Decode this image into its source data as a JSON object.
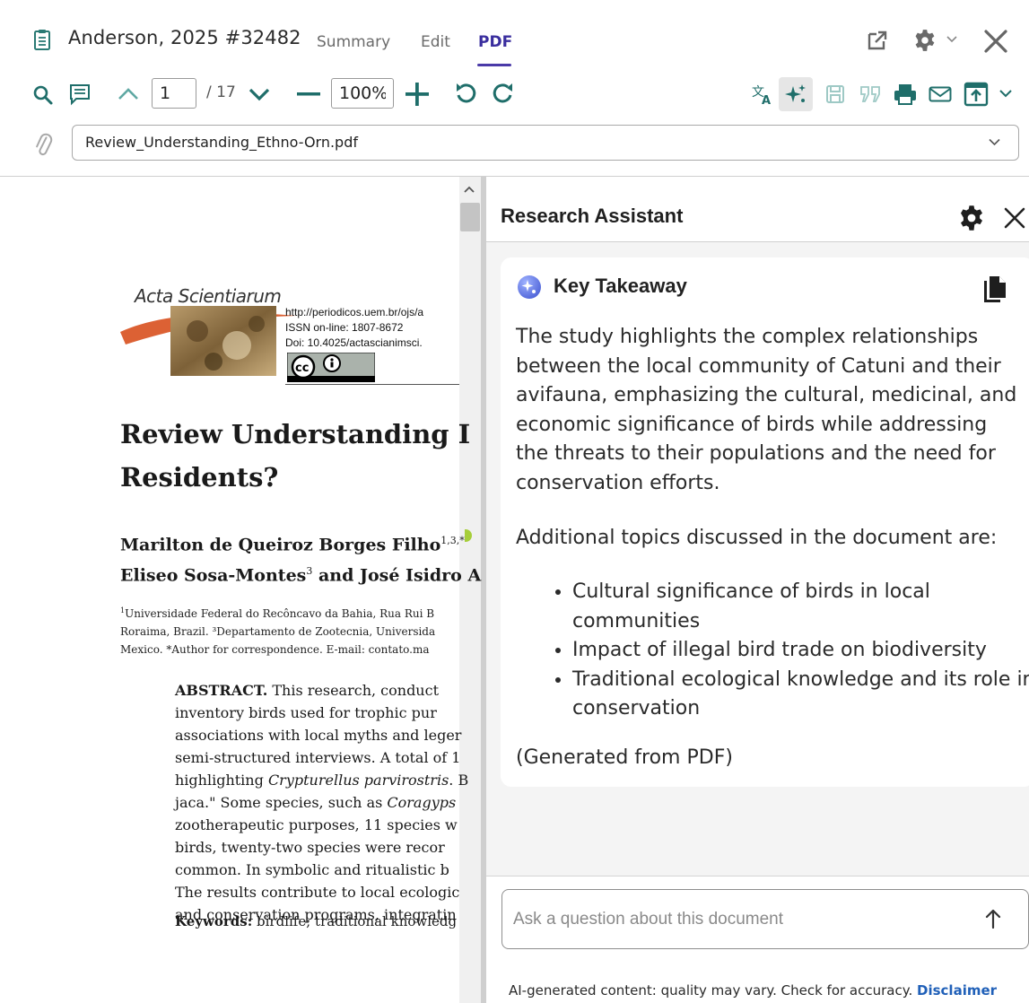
{
  "header": {
    "reference_title": "Anderson, 2025 #32482",
    "tabs": [
      {
        "label": "Summary",
        "active": false
      },
      {
        "label": "Edit",
        "active": false
      },
      {
        "label": "PDF",
        "active": true
      }
    ]
  },
  "toolbar": {
    "page_current": "1",
    "page_total": "/ 17",
    "zoom": "100%"
  },
  "attachment": {
    "file_name": "Review_Understanding_Ethno-Orn.pdf"
  },
  "pdf": {
    "journal_name": "Acta Scientiarum",
    "journal_url": "http://periodicos.uem.br/ojs/a",
    "issn": "ISSN on-line: 1807-8672",
    "doi": "Doi: 10.4025/actascianimsci.",
    "title_lines": [
      "Review Understanding I",
      "Residents?"
    ],
    "author_lines": [
      "Marilton de Queiroz Borges Filho",
      "Eliseo Sosa-Montes",
      " and José Isidro A"
    ],
    "author_sup_1": "1,3,*",
    "author_sup_2": "3",
    "affiliation_lines": [
      "Universidade Federal do Recôncavo da Bahia, Rua Rui B",
      "Roraima, Brazil. ³Departamento de Zootecnia, Universida",
      "Mexico. *Author for correspondence. E-mail: contato.ma"
    ],
    "affiliation_sup": "1",
    "abstract_label": "ABSTRACT.",
    "abstract_first": " This research, conduct",
    "abstract_lines": [
      "inventory birds used for trophic pur",
      "associations with local myths and leger",
      "semi-structured interviews. A total of 1",
      "highlighting ",
      "jaca.\" Some species, such as ",
      "zootherapeutic purposes, 11 species w",
      "birds, twenty-two species were recor",
      "common. In symbolic and ritualistic b",
      "The results contribute to local ecologic",
      "and conservation programs, integratin"
    ],
    "abstract_italic_1": "Crypturellus parvirostris",
    "abstract_after_italic_1": ". B",
    "abstract_italic_2": "Coragyps",
    "keywords_label": "Keywords:",
    "keywords_text": " birdlife; traditional knowledg"
  },
  "assistant": {
    "title": "Research Assistant",
    "section_heading": "Key Takeaway",
    "summary": "The study highlights the complex relationships between the local community of Catuni and their avifauna, emphasizing the cultural, medicinal, and economic significance of birds while addressing the threats to their populations and the need for conservation efforts.",
    "additional_intro": "Additional topics discussed in the document are:",
    "topics": [
      "Cultural significance of birds in local communities",
      "Impact of illegal bird trade on biodiversity",
      "Traditional ecological knowledge and its role in conservation"
    ],
    "source_note": "(Generated from PDF)",
    "ask_placeholder": "Ask a question about this document",
    "disclaimer": "AI-generated content: quality may vary. Check for accuracy. ",
    "disclaimer_link": "Disclaimer"
  },
  "colors": {
    "accent": "#4a3aa8",
    "toolbar_icon": "#1f6e6a",
    "toolbar_icon_dark": "#333333",
    "link": "#2060b8",
    "panel_bg": "#f4f4f4"
  },
  "icons": {
    "reference": "clipboard-icon",
    "open_external": "open-external-icon",
    "settings": "gear-icon",
    "close": "close-icon",
    "search": "search-icon",
    "annotations": "comment-icon",
    "prev_page": "chevron-up-icon",
    "next_page": "chevron-down-icon",
    "zoom_out": "minus-icon",
    "zoom_in": "plus-icon",
    "rotate_ccw": "rotate-ccw-icon",
    "rotate_cw": "rotate-cw-icon",
    "translate": "translate-icon",
    "ai": "sparkle-icon",
    "save": "save-icon",
    "quote": "quote-icon",
    "print": "print-icon",
    "email": "mail-icon",
    "export": "export-icon",
    "attachment": "paperclip-icon",
    "copy": "copy-icon",
    "send": "send-arrow-icon"
  }
}
